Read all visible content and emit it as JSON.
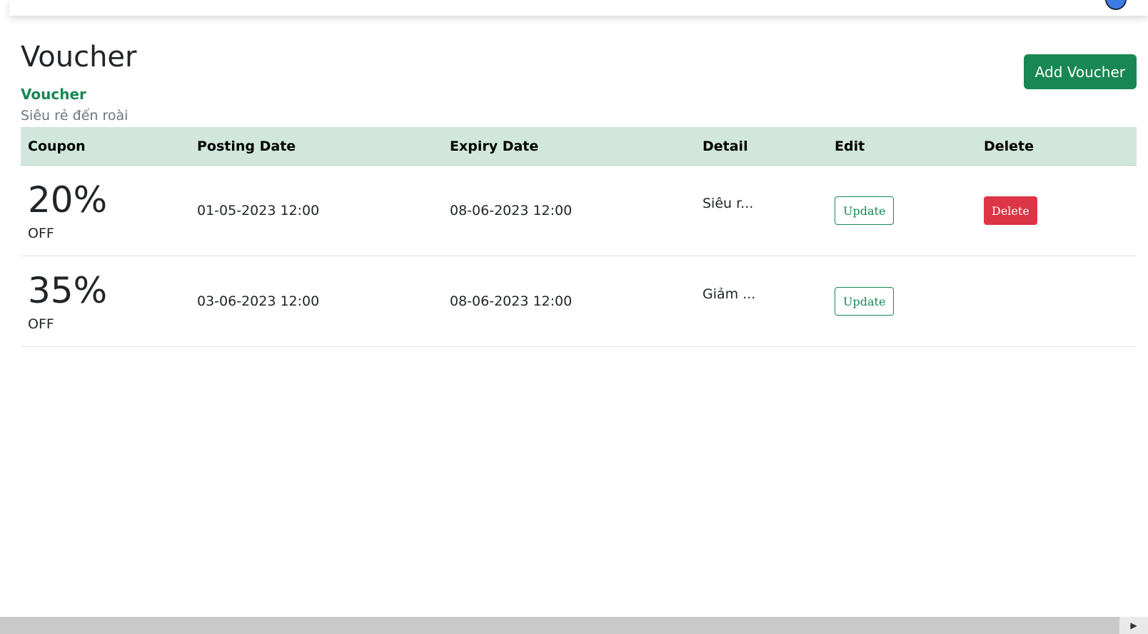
{
  "header": {
    "title": "Voucher",
    "breadcrumb": "Voucher",
    "subtitle": "Siêu rẻ đến roài",
    "add_button": "Add Voucher"
  },
  "table": {
    "columns": [
      "Coupon",
      "Posting Date",
      "Expiry Date",
      "Detail",
      "Edit",
      "Delete"
    ],
    "rows": [
      {
        "discount": "20%",
        "off_label": "OFF",
        "posting_date": "01-05-2023 12:00",
        "expiry_date": "08-06-2023 12:00",
        "detail": "Siêu r...",
        "update_label": "Update",
        "delete_label": "Delete"
      },
      {
        "discount": "35%",
        "off_label": "OFF",
        "posting_date": "03-06-2023 12:00",
        "expiry_date": "08-06-2023 12:00",
        "detail": "Giảm ...",
        "update_label": "Update"
      }
    ]
  },
  "icons": {
    "avatar": "user-avatar-icon",
    "scroll_right": "arrow-right-icon"
  },
  "colors": {
    "primary": "#198754",
    "danger": "#dc3545",
    "table_header_bg": "#d1e7dd"
  }
}
